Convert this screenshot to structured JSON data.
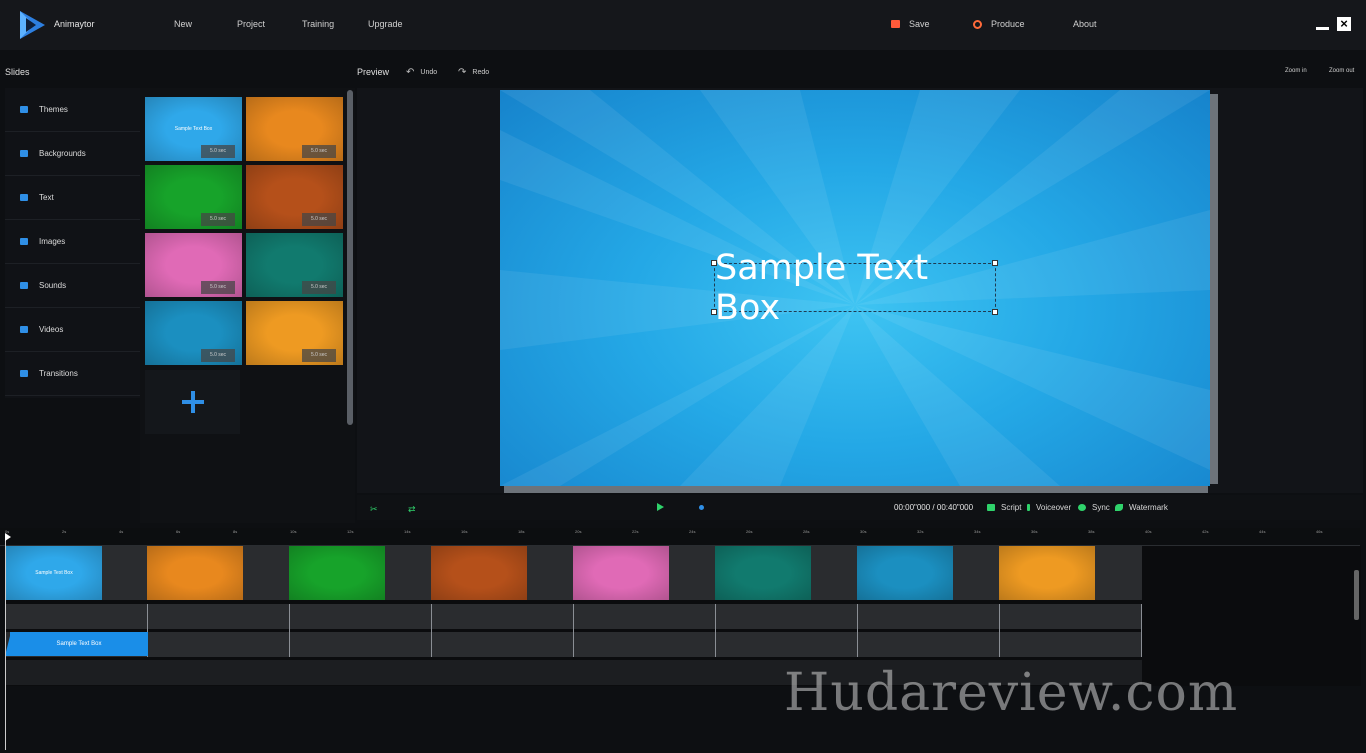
{
  "app": {
    "title": "Animaytor"
  },
  "nav": {
    "new": "New",
    "project": "Project",
    "training": "Training",
    "upgrade": "Upgrade",
    "save": "Save",
    "produce": "Produce",
    "about": "About"
  },
  "panels": {
    "slides": "Slides",
    "preview": "Preview",
    "undo": "Undo",
    "redo": "Redo",
    "zoom_in": "Zoom in",
    "zoom_out": "Zoom out"
  },
  "sidebar": {
    "items": [
      {
        "label": "Themes",
        "icon": "themes-icon"
      },
      {
        "label": "Backgrounds",
        "icon": "backgrounds-icon"
      },
      {
        "label": "Text",
        "icon": "text-icon"
      },
      {
        "label": "Images",
        "icon": "camera-icon"
      },
      {
        "label": "Sounds",
        "icon": "speaker-icon"
      },
      {
        "label": "Videos",
        "icon": "video-icon"
      },
      {
        "label": "Transitions",
        "icon": "transitions-icon"
      }
    ]
  },
  "slides": [
    {
      "duration": "5.0 sec",
      "text": "Sample Text Box",
      "color": "#2fa8ea"
    },
    {
      "duration": "5.0 sec",
      "color": "#e8881e"
    },
    {
      "duration": "5.0 sec",
      "color": "#17a32a"
    },
    {
      "duration": "5.0 sec",
      "color": "#b5501a"
    },
    {
      "duration": "5.0 sec",
      "color": "#e06ab6"
    },
    {
      "duration": "5.0 sec",
      "color": "#117a6e"
    },
    {
      "duration": "5.0 sec",
      "color": "#1b8fc0"
    },
    {
      "duration": "5.0 sec",
      "color": "#ee9a22"
    }
  ],
  "canvas": {
    "text": "Sample Text Box"
  },
  "controls": {
    "timecode": "00:00\"000 / 00:40\"000",
    "script": "Script",
    "voiceover": "Voiceover",
    "sync": "Sync",
    "watermark": "Watermark"
  },
  "ruler": {
    "labels": [
      "0s",
      "2s",
      "4s",
      "6s",
      "8s",
      "10s",
      "12s",
      "14s",
      "16s",
      "18s",
      "20s",
      "22s",
      "24s",
      "26s",
      "28s",
      "30s",
      "32s",
      "34s",
      "36s",
      "38s",
      "40s",
      "42s",
      "44s",
      "46s"
    ]
  },
  "timeline": {
    "text_clip": "Sample Text Box",
    "first_clip_text": "Sample Text Box"
  },
  "overlay": {
    "watermark": "Hudareview.com"
  },
  "colors": {
    "accent": "#2f8fe6",
    "green": "#2fd36b",
    "save": "#ff5a3a"
  }
}
